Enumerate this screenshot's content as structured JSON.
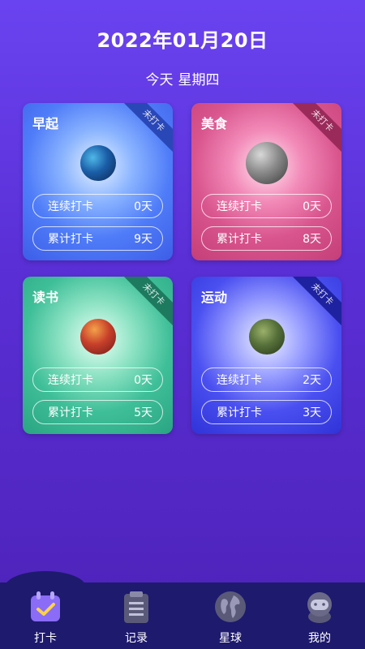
{
  "header": {
    "date": "2022年01月20日",
    "today": "今天",
    "weekday": "星期四"
  },
  "cards": [
    {
      "title": "早起",
      "ribbon": "未打卡",
      "streak_label": "连续打卡",
      "streak_value": "0天",
      "total_label": "累计打卡",
      "total_value": "9天",
      "planet_icon": "blue-planet-icon"
    },
    {
      "title": "美食",
      "ribbon": "未打卡",
      "streak_label": "连续打卡",
      "streak_value": "0天",
      "total_label": "累计打卡",
      "total_value": "8天",
      "planet_icon": "grey-planet-icon"
    },
    {
      "title": "读书",
      "ribbon": "未打卡",
      "streak_label": "连续打卡",
      "streak_value": "0天",
      "total_label": "累计打卡",
      "total_value": "5天",
      "planet_icon": "red-planet-icon"
    },
    {
      "title": "运动",
      "ribbon": "未打卡",
      "streak_label": "连续打卡",
      "streak_value": "2天",
      "total_label": "累计打卡",
      "total_value": "3天",
      "planet_icon": "green-planet-icon"
    }
  ],
  "tabs": [
    {
      "label": "打卡",
      "icon": "calendar-check-icon",
      "active": true
    },
    {
      "label": "记录",
      "icon": "clipboard-icon",
      "active": false
    },
    {
      "label": "星球",
      "icon": "globe-icon",
      "active": false
    },
    {
      "label": "我的",
      "icon": "astronaut-icon",
      "active": false
    }
  ],
  "colors": {
    "background": "#5a2fd6",
    "tabbar": "#1e1a6e",
    "active_tab_icon": "#7b5cf5"
  }
}
